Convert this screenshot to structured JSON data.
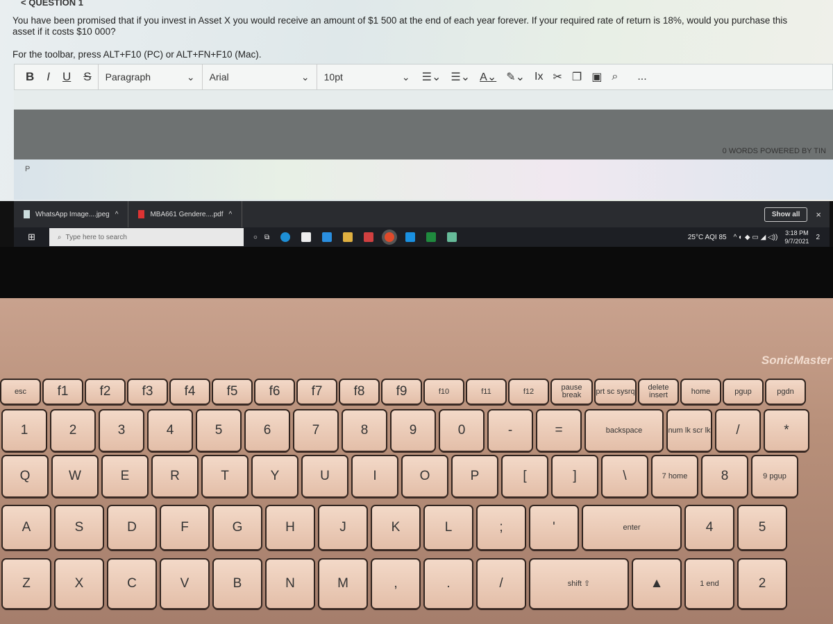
{
  "question": {
    "heading": "< QUESTION 1",
    "text": "You have been promised that if you invest in Asset X you would receive an amount of $1 500 at the end of each year forever. If your required rate of return is 18%, would you purchase this asset if it costs $10 000?",
    "hint": "For the toolbar, press ALT+F10 (PC) or ALT+FN+F10 (Mac)."
  },
  "toolbar": {
    "bold": "B",
    "italic": "I",
    "underline": "U",
    "strike": "S",
    "paragraph": "Paragraph",
    "font": "Arial",
    "size": "10pt",
    "more": "..."
  },
  "editor": {
    "word_count": "0 WORDS  POWERED BY TIN",
    "path": "P"
  },
  "downloads": {
    "items": [
      "WhatsApp Image....jpeg",
      "MBA661 Gendere....pdf"
    ],
    "show_all": "Show all",
    "close": "×"
  },
  "taskbar": {
    "search_placeholder": "Type here to search",
    "weather": "25°C  AQI 85",
    "time": "3:18 PM",
    "date": "9/7/2021",
    "notifications": "2"
  },
  "keyboard": {
    "brand": "SonicMaster",
    "rows": [
      [
        "esc",
        "f1",
        "f2",
        "f3",
        "f4",
        "f5",
        "f6",
        "f7",
        "f8",
        "f9",
        "f10",
        "f11",
        "f12",
        "pause break",
        "prt sc sysrq",
        "delete insert",
        "home",
        "pgup",
        "pgdn"
      ],
      [
        "1",
        "2",
        "3",
        "4",
        "5",
        "6",
        "7",
        "8",
        "9",
        "0",
        "-",
        "=",
        "backspace",
        "num lk scr lk",
        "/",
        "*"
      ],
      [
        "Q",
        "W",
        "E",
        "R",
        "T",
        "Y",
        "U",
        "I",
        "O",
        "P",
        "[",
        "]",
        "\\",
        "7 home",
        "8",
        "9 pgup"
      ],
      [
        "A",
        "S",
        "D",
        "F",
        "G",
        "H",
        "J",
        "K",
        "L",
        ";",
        "'",
        "enter",
        "4",
        "5"
      ],
      [
        "Z",
        "X",
        "C",
        "V",
        "B",
        "N",
        "M",
        ",",
        ".",
        "/",
        "shift ⇧",
        "▲",
        "1 end",
        "2"
      ]
    ]
  }
}
